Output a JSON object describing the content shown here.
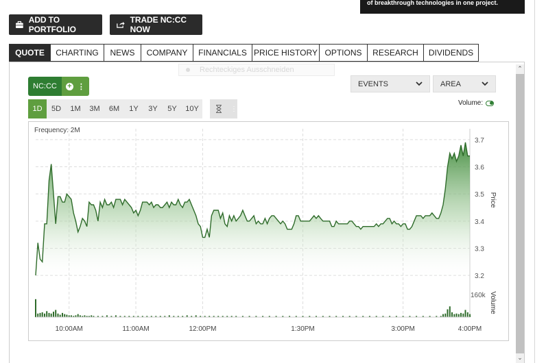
{
  "ad": {
    "text": "of breakthrough technologies in one project."
  },
  "toolbar": {
    "add_portfolio": "ADD TO PORTFOLIO",
    "trade": "TRADE NC:CC NOW"
  },
  "tabs": [
    "QUOTE",
    "CHARTING",
    "NEWS",
    "COMPANY",
    "FINANCIALS",
    "PRICE HISTORY",
    "OPTIONS",
    "RESEARCH",
    "DIVIDENDS"
  ],
  "active_tab": "QUOTE",
  "ghost_menu": "Rechteckiges Ausschneiden",
  "symbol": "NC:CC",
  "ranges": [
    "1D",
    "5D",
    "1M",
    "3M",
    "6M",
    "1Y",
    "3Y",
    "5Y",
    "10Y"
  ],
  "active_range": "1D",
  "events_select": "EVENTS",
  "chart_style_select": "AREA",
  "volume_toggle": {
    "label": "Volume:",
    "on": true
  },
  "colors": {
    "accent_green": "#2e7d32",
    "light_green": "#5f9e3f",
    "dark_button": "#2b2b2b"
  },
  "chart_data": {
    "type": "area",
    "frequency_label": "Frequency: 2M",
    "ylabel": "Price",
    "volume_label": "Volume",
    "volume_max_label": "160k",
    "y_ticks": [
      "3.7",
      "3.6",
      "3.5",
      "3.4",
      "3.3",
      "3.2"
    ],
    "ylim": [
      3.18,
      3.72
    ],
    "x_ticks": [
      {
        "label": "10:00AM",
        "t": 30
      },
      {
        "label": "11:00AM",
        "t": 90
      },
      {
        "label": "12:00PM",
        "t": 150
      },
      {
        "label": "1:30PM",
        "t": 240
      },
      {
        "label": "3:00PM",
        "t": 330
      },
      {
        "label": "4:00PM",
        "t": 390
      }
    ],
    "xlim": [
      0,
      390
    ],
    "price": [
      [
        0,
        3.2
      ],
      [
        2,
        3.32
      ],
      [
        4,
        3.26
      ],
      [
        6,
        3.25
      ],
      [
        8,
        3.39
      ],
      [
        10,
        3.39
      ],
      [
        12,
        3.55
      ],
      [
        14,
        3.61
      ],
      [
        16,
        3.5
      ],
      [
        18,
        3.39
      ],
      [
        20,
        3.49
      ],
      [
        22,
        3.49
      ],
      [
        24,
        3.47
      ],
      [
        26,
        3.47
      ],
      [
        28,
        3.5
      ],
      [
        30,
        3.49
      ],
      [
        32,
        3.48
      ],
      [
        34,
        3.43
      ],
      [
        36,
        3.4
      ],
      [
        38,
        3.36
      ],
      [
        40,
        3.38
      ],
      [
        42,
        3.41
      ],
      [
        44,
        3.4
      ],
      [
        46,
        3.38
      ],
      [
        48,
        3.47
      ],
      [
        50,
        3.46
      ],
      [
        52,
        3.46
      ],
      [
        54,
        3.44
      ],
      [
        56,
        3.4
      ],
      [
        58,
        3.47
      ],
      [
        60,
        3.45
      ],
      [
        62,
        3.48
      ],
      [
        64,
        3.46
      ],
      [
        66,
        3.46
      ],
      [
        68,
        3.47
      ],
      [
        70,
        3.45
      ],
      [
        72,
        3.48
      ],
      [
        74,
        3.48
      ],
      [
        76,
        3.48
      ],
      [
        78,
        3.46
      ],
      [
        80,
        3.48
      ],
      [
        82,
        3.47
      ],
      [
        84,
        3.46
      ],
      [
        86,
        3.45
      ],
      [
        88,
        3.43
      ],
      [
        90,
        3.44
      ],
      [
        92,
        3.42
      ],
      [
        94,
        3.44
      ],
      [
        96,
        3.47
      ],
      [
        98,
        3.47
      ],
      [
        100,
        3.47
      ],
      [
        102,
        3.46
      ],
      [
        104,
        3.47
      ],
      [
        106,
        3.45
      ],
      [
        108,
        3.46
      ],
      [
        110,
        3.46
      ],
      [
        112,
        3.45
      ],
      [
        114,
        3.45
      ],
      [
        116,
        3.46
      ],
      [
        118,
        3.47
      ],
      [
        120,
        3.45
      ],
      [
        122,
        3.47
      ],
      [
        124,
        3.46
      ],
      [
        126,
        3.46
      ],
      [
        128,
        3.48
      ],
      [
        130,
        3.46
      ],
      [
        132,
        3.45
      ],
      [
        134,
        3.47
      ],
      [
        136,
        3.47
      ],
      [
        138,
        3.48
      ],
      [
        140,
        3.46
      ],
      [
        142,
        3.44
      ],
      [
        144,
        3.42
      ],
      [
        146,
        3.39
      ],
      [
        148,
        3.38
      ],
      [
        150,
        3.34
      ],
      [
        152,
        3.34
      ],
      [
        154,
        3.37
      ],
      [
        156,
        3.34
      ],
      [
        158,
        3.42
      ],
      [
        160,
        3.44
      ],
      [
        162,
        3.44
      ],
      [
        164,
        3.44
      ],
      [
        166,
        3.41
      ],
      [
        168,
        3.43
      ],
      [
        170,
        3.39
      ],
      [
        172,
        3.38
      ],
      [
        174,
        3.42
      ],
      [
        176,
        3.4
      ],
      [
        178,
        3.42
      ],
      [
        180,
        3.4
      ],
      [
        182,
        3.41
      ],
      [
        184,
        3.42
      ],
      [
        186,
        3.44
      ],
      [
        188,
        3.42
      ],
      [
        190,
        3.4
      ],
      [
        192,
        3.4
      ],
      [
        194,
        3.41
      ],
      [
        196,
        3.42
      ],
      [
        198,
        3.39
      ],
      [
        200,
        3.4
      ],
      [
        202,
        3.39
      ],
      [
        204,
        3.39
      ],
      [
        206,
        3.41
      ],
      [
        208,
        3.39
      ],
      [
        210,
        3.41
      ],
      [
        212,
        3.42
      ],
      [
        214,
        3.42
      ],
      [
        216,
        3.41
      ],
      [
        218,
        3.4
      ],
      [
        220,
        3.39
      ],
      [
        222,
        3.4
      ],
      [
        224,
        3.39
      ],
      [
        226,
        3.37
      ],
      [
        228,
        3.37
      ],
      [
        230,
        3.37
      ],
      [
        232,
        3.39
      ],
      [
        234,
        3.42
      ],
      [
        236,
        3.42
      ],
      [
        238,
        3.4
      ],
      [
        240,
        3.4
      ],
      [
        242,
        3.4
      ],
      [
        244,
        3.4
      ],
      [
        246,
        3.4
      ],
      [
        248,
        3.41
      ],
      [
        250,
        3.42
      ],
      [
        252,
        3.41
      ],
      [
        254,
        3.42
      ],
      [
        256,
        3.41
      ],
      [
        258,
        3.4
      ],
      [
        260,
        3.4
      ],
      [
        262,
        3.4
      ],
      [
        264,
        3.4
      ],
      [
        266,
        3.38
      ],
      [
        268,
        3.38
      ],
      [
        270,
        3.4
      ],
      [
        272,
        3.39
      ],
      [
        274,
        3.39
      ],
      [
        276,
        3.39
      ],
      [
        278,
        3.39
      ],
      [
        280,
        3.39
      ],
      [
        282,
        3.4
      ],
      [
        284,
        3.4
      ],
      [
        286,
        3.39
      ],
      [
        288,
        3.38
      ],
      [
        290,
        3.38
      ],
      [
        292,
        3.37
      ],
      [
        294,
        3.38
      ],
      [
        296,
        3.38
      ],
      [
        298,
        3.38
      ],
      [
        300,
        3.38
      ],
      [
        302,
        3.38
      ],
      [
        304,
        3.38
      ],
      [
        306,
        3.39
      ],
      [
        308,
        3.38
      ],
      [
        310,
        3.39
      ],
      [
        312,
        3.39
      ],
      [
        314,
        3.4
      ],
      [
        316,
        3.41
      ],
      [
        318,
        3.41
      ],
      [
        320,
        3.39
      ],
      [
        322,
        3.4
      ],
      [
        324,
        3.39
      ],
      [
        326,
        3.39
      ],
      [
        328,
        3.38
      ],
      [
        330,
        3.39
      ],
      [
        332,
        3.39
      ],
      [
        334,
        3.37
      ],
      [
        336,
        3.37
      ],
      [
        338,
        3.38
      ],
      [
        340,
        3.4
      ],
      [
        342,
        3.42
      ],
      [
        344,
        3.42
      ],
      [
        346,
        3.42
      ],
      [
        348,
        3.41
      ],
      [
        350,
        3.42
      ],
      [
        352,
        3.42
      ],
      [
        354,
        3.42
      ],
      [
        356,
        3.43
      ],
      [
        358,
        3.42
      ],
      [
        360,
        3.41
      ],
      [
        362,
        3.41
      ],
      [
        364,
        3.43
      ],
      [
        366,
        3.46
      ],
      [
        368,
        3.52
      ],
      [
        370,
        3.6
      ],
      [
        372,
        3.65
      ],
      [
        374,
        3.63
      ],
      [
        376,
        3.65
      ],
      [
        378,
        3.62
      ],
      [
        380,
        3.64
      ],
      [
        382,
        3.68
      ],
      [
        384,
        3.64
      ],
      [
        386,
        3.69
      ],
      [
        388,
        3.64
      ],
      [
        390,
        3.64
      ]
    ],
    "volume": [
      [
        0,
        30
      ],
      [
        2,
        6
      ],
      [
        4,
        7
      ],
      [
        6,
        8
      ],
      [
        8,
        6
      ],
      [
        10,
        10
      ],
      [
        12,
        7
      ],
      [
        14,
        6
      ],
      [
        16,
        9
      ],
      [
        18,
        12
      ],
      [
        20,
        6
      ],
      [
        22,
        4
      ],
      [
        24,
        7
      ],
      [
        26,
        5
      ],
      [
        28,
        4
      ],
      [
        30,
        3
      ],
      [
        32,
        3
      ],
      [
        34,
        2
      ],
      [
        36,
        3
      ],
      [
        38,
        5
      ],
      [
        40,
        3
      ],
      [
        42,
        2
      ],
      [
        44,
        3
      ],
      [
        46,
        2
      ],
      [
        48,
        2
      ],
      [
        50,
        3
      ],
      [
        52,
        2
      ],
      [
        56,
        2
      ],
      [
        60,
        2
      ],
      [
        64,
        3
      ],
      [
        68,
        2
      ],
      [
        72,
        3
      ],
      [
        76,
        2
      ],
      [
        80,
        2
      ],
      [
        84,
        2
      ],
      [
        88,
        2
      ],
      [
        92,
        2
      ],
      [
        96,
        2
      ],
      [
        100,
        2
      ],
      [
        104,
        2
      ],
      [
        108,
        2
      ],
      [
        112,
        2
      ],
      [
        116,
        2
      ],
      [
        120,
        3
      ],
      [
        124,
        2
      ],
      [
        128,
        2
      ],
      [
        132,
        2
      ],
      [
        136,
        3
      ],
      [
        140,
        2
      ],
      [
        144,
        3
      ],
      [
        148,
        2
      ],
      [
        152,
        2
      ],
      [
        156,
        2
      ],
      [
        160,
        2
      ],
      [
        164,
        2
      ],
      [
        168,
        2
      ],
      [
        172,
        2
      ],
      [
        176,
        2
      ],
      [
        180,
        2
      ],
      [
        186,
        2
      ],
      [
        192,
        2
      ],
      [
        198,
        2
      ],
      [
        204,
        2
      ],
      [
        210,
        2
      ],
      [
        216,
        2
      ],
      [
        222,
        2
      ],
      [
        228,
        2
      ],
      [
        234,
        2
      ],
      [
        240,
        2
      ],
      [
        246,
        2
      ],
      [
        252,
        2
      ],
      [
        258,
        2
      ],
      [
        264,
        2
      ],
      [
        270,
        2
      ],
      [
        276,
        2
      ],
      [
        282,
        2
      ],
      [
        288,
        2
      ],
      [
        294,
        2
      ],
      [
        300,
        2
      ],
      [
        306,
        2
      ],
      [
        312,
        2
      ],
      [
        318,
        2
      ],
      [
        324,
        2
      ],
      [
        330,
        2
      ],
      [
        336,
        2
      ],
      [
        342,
        2
      ],
      [
        348,
        2
      ],
      [
        354,
        2
      ],
      [
        360,
        2
      ],
      [
        364,
        2
      ],
      [
        366,
        5
      ],
      [
        368,
        6
      ],
      [
        370,
        13
      ],
      [
        372,
        18
      ],
      [
        374,
        8
      ],
      [
        376,
        5
      ],
      [
        378,
        6
      ],
      [
        380,
        5
      ],
      [
        382,
        7
      ],
      [
        384,
        6
      ],
      [
        386,
        12
      ],
      [
        388,
        8
      ],
      [
        390,
        5
      ]
    ],
    "volume_max": 40,
    "grid": true,
    "fill_color_top": "#3f8a3a",
    "line_color": "#2e6b2a"
  }
}
